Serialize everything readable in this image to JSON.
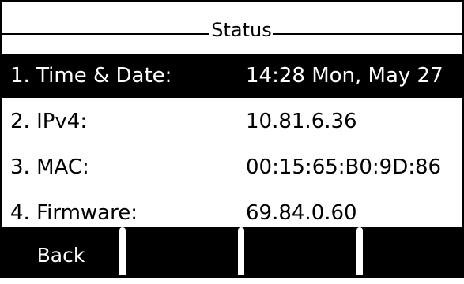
{
  "screen": {
    "title": "Status"
  },
  "menu": {
    "items": [
      {
        "label": "1.  Time & Date:",
        "value": "14:28 Mon, May 27",
        "selected": true
      },
      {
        "label": "2.  IPv4:",
        "value": "10.81.6.36",
        "selected": false
      },
      {
        "label": "3.  MAC:",
        "value": "00:15:65:B0:9D:86",
        "selected": false
      },
      {
        "label": "4.  Firmware:",
        "value": "69.84.0.60",
        "selected": false
      }
    ]
  },
  "softkeys": {
    "key1": "Back",
    "key2": "",
    "key3": "",
    "key4": ""
  }
}
